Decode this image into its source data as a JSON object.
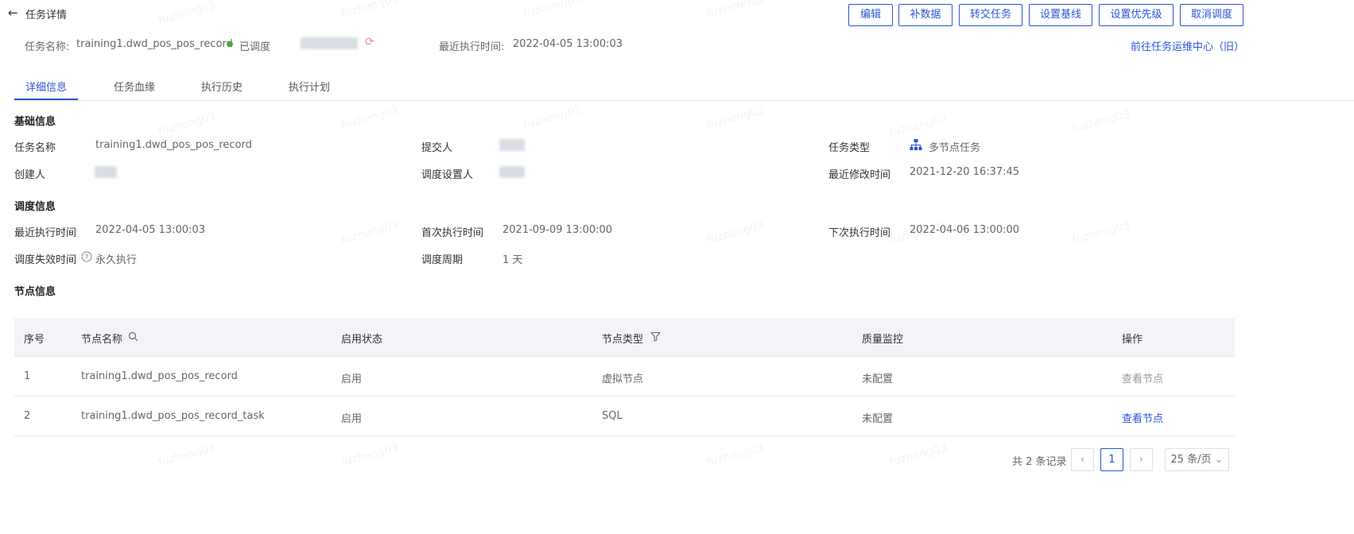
{
  "header": {
    "title": "任务详情",
    "buttons": [
      "编辑",
      "补数据",
      "转交任务",
      "设置基线",
      "设置优先级",
      "取消调度"
    ],
    "task_name_label": "任务名称:",
    "task_name": "training1.dwd_pos_pos_record",
    "status": "已调度",
    "last_exec_label": "最近执行时间:",
    "last_exec": "2022-04-05 13:00:03",
    "ops_link": "前往任务运维中心（旧）"
  },
  "tabs": [
    "详细信息",
    "任务血缘",
    "执行历史",
    "执行计划"
  ],
  "basic": {
    "section": "基础信息",
    "task_name_label": "任务名称",
    "task_name": "training1.dwd_pos_pos_record",
    "submitter_label": "提交人",
    "task_type_label": "任务类型",
    "task_type": "多节点任务",
    "creator_label": "创建人",
    "scheduler_label": "调度设置人",
    "modified_label": "最近修改时间",
    "modified": "2021-12-20 16:37:45"
  },
  "schedule": {
    "section": "调度信息",
    "last_exec_label": "最近执行时间",
    "last_exec": "2022-04-05 13:00:03",
    "first_exec_label": "首次执行时间",
    "first_exec": "2021-09-09 13:00:00",
    "next_exec_label": "下次执行时间",
    "next_exec": "2022-04-06 13:00:00",
    "expire_label": "调度失效时间",
    "expire": "永久执行",
    "period_label": "调度周期",
    "period": "1 天"
  },
  "nodes": {
    "section": "节点信息",
    "columns": [
      "序号",
      "节点名称",
      "启用状态",
      "节点类型",
      "质量监控",
      "操作"
    ],
    "rows": [
      {
        "no": "1",
        "name": "training1.dwd_pos_pos_record",
        "status": "启用",
        "type": "虚拟节点",
        "quality": "未配置",
        "action": "查看节点"
      },
      {
        "no": "2",
        "name": "training1.dwd_pos_pos_record_task",
        "status": "启用",
        "type": "SQL",
        "quality": "未配置",
        "action": "查看节点"
      }
    ]
  },
  "pagination": {
    "total": "共 2 条记录",
    "current": "1",
    "page_size": "25 条/页"
  },
  "watermark": "fuzheng03",
  "colors": {
    "accent": "#2b55d6",
    "status_green": "#3cb531"
  }
}
